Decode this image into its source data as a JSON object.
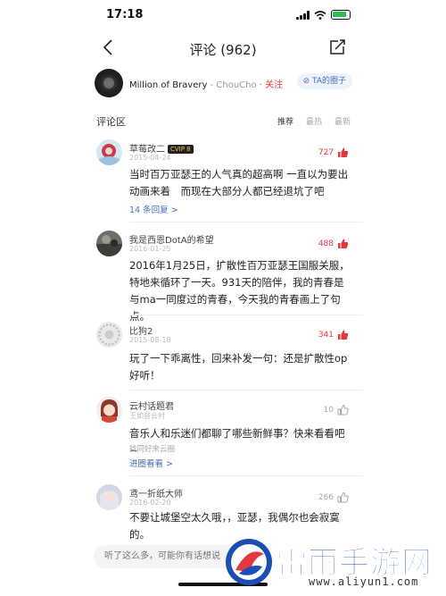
{
  "status_bar": {
    "time": "17:18"
  },
  "nav": {
    "title": "评论 (962)"
  },
  "song": {
    "title": "Million of Bravery",
    "separator": " - ",
    "artist": "ChouCho",
    "follow": " · 关注",
    "circle_button": "TA的圈子"
  },
  "section": {
    "label": "评论区",
    "tabs": [
      "推荐",
      "最热",
      "最新"
    ]
  },
  "comments": [
    {
      "username": "草莓改二",
      "badge": "CVIP 8",
      "date": "2015-04-24",
      "likes": "727",
      "text": "当时百万亚瑟王的人气真的超高啊 一直以为要出动画来着　而现在大部分人都已经退坑了吧",
      "replies": "14 条回复 >"
    },
    {
      "username": "我是西恩DotA的希望",
      "date": "2016-01-25",
      "likes": "488",
      "text": "2016年1月25日，扩散性百万亚瑟王国服关服，特地来循环了一天。931天的陪伴，我的青春是与ma一同度过的青春，今天我的青春画上了句点。"
    },
    {
      "username": "比狗2",
      "date": "2015-08-18",
      "likes": "341",
      "text": "玩了一下乖离性，回来补发一句：还是扩散性op好听！"
    },
    {
      "username": "云村话题君",
      "date": "王如音云村",
      "likes": "10",
      "text": "音乐人和乐迷们都聊了哪些新鲜事？快来看看吧~",
      "sub": "找同好来云圈",
      "replies": "进圈看看 >"
    },
    {
      "username": "鸢一折纸大师",
      "date": "2016-02-20",
      "likes": "266",
      "text": "不要让城堡空太久哦，，亚瑟，我偶尔也会寂寞的。"
    }
  ],
  "input": {
    "placeholder": "听了这么多，可能你有话想说"
  },
  "watermark": {
    "brand": "雷雨手游网",
    "url": "www.aliyun1.com"
  },
  "colors": {
    "accent_red": "#e4393c",
    "link_blue": "#4a6fb5",
    "brand_blue": "#1b4db3"
  }
}
